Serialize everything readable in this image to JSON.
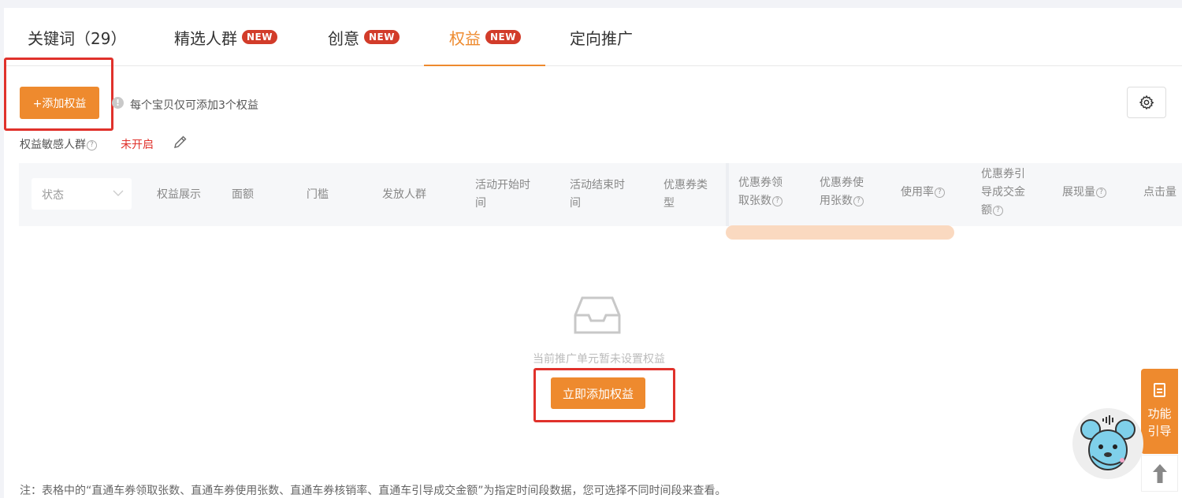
{
  "tabs": [
    {
      "label": "关键词（29）",
      "badge": ""
    },
    {
      "label": "精选人群",
      "badge": "NEW"
    },
    {
      "label": "创意",
      "badge": "NEW"
    },
    {
      "label": "权益",
      "badge": "NEW"
    },
    {
      "label": "定向推广",
      "badge": ""
    }
  ],
  "active_tab": "权益",
  "toolbar": {
    "add_label": "+添加权益",
    "info_glyph": "!",
    "hint": "每个宝贝仅可添加3个权益"
  },
  "sensitive": {
    "label": "权益敏感人群",
    "help_glyph": "?",
    "status": "未开启"
  },
  "table": {
    "status_placeholder": "状态",
    "columns": [
      {
        "text": "权益展示"
      },
      {
        "text": "面额"
      },
      {
        "text": "门槛"
      },
      {
        "text": "发放人群"
      },
      {
        "text": "活动开始时",
        "text2": "间"
      },
      {
        "text": "活动结束时",
        "text2": "间"
      },
      {
        "text": "优惠券类",
        "text2": "型"
      },
      {
        "text": "优惠券领",
        "text2": "取张数"
      },
      {
        "text": "优惠券使",
        "text2": "用张数"
      },
      {
        "text": "使用率"
      },
      {
        "text": "优惠券引",
        "text2": "导成交金",
        "text3": "额"
      },
      {
        "text": "展现量"
      },
      {
        "text": "点击量"
      }
    ]
  },
  "empty": {
    "message": "当前推广单元暂未设置权益",
    "button_label": "立即添加权益"
  },
  "note": "注：表格中的“直通车券领取张数、直通车券使用张数、直通车券核销率、直通车引导成交金额”为指定时间段数据，您可选择不同时间段来查看。",
  "float": {
    "guide_line1": "功能",
    "guide_line2": "引导"
  },
  "colors": {
    "accent": "#ee8a2e",
    "badge": "#d23c2a",
    "highlight": "#e0312b"
  }
}
